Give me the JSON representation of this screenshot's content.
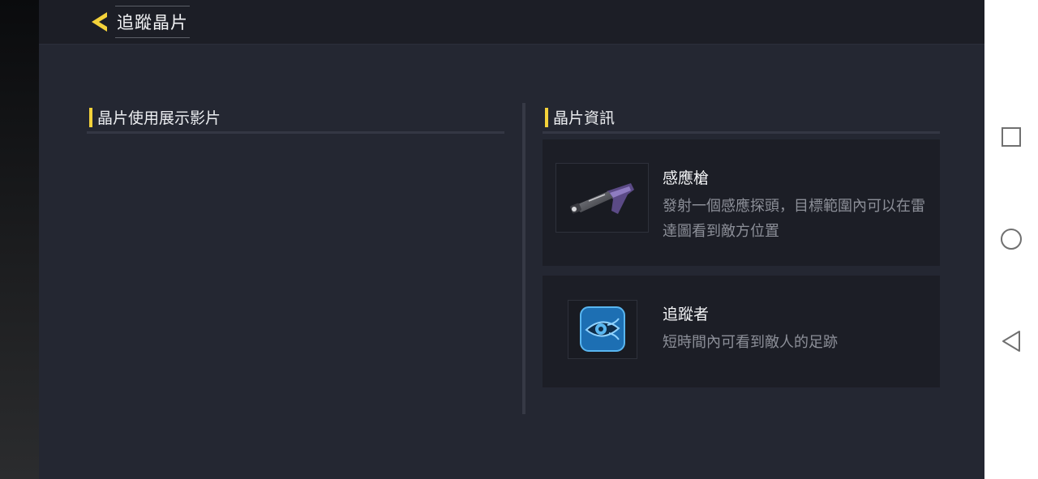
{
  "header": {
    "title": "追蹤晶片",
    "back_icon": "chevron-left-icon",
    "accent_color": "#f4d23a"
  },
  "left_panel": {
    "title": "晶片使用展示影片"
  },
  "right_panel": {
    "title": "晶片資訊",
    "items": [
      {
        "name": "感應槍",
        "description": "發射一個感應探頭，目標範圍內可以在雷達圖看到敵方位置",
        "icon": "sensor-gun-icon"
      },
      {
        "name": "追蹤者",
        "description": "短時間內可看到敵人的足跡",
        "icon": "eye-tracker-icon"
      }
    ]
  },
  "system_nav": {
    "buttons": [
      "recent-apps-icon",
      "home-icon",
      "back-icon"
    ]
  }
}
